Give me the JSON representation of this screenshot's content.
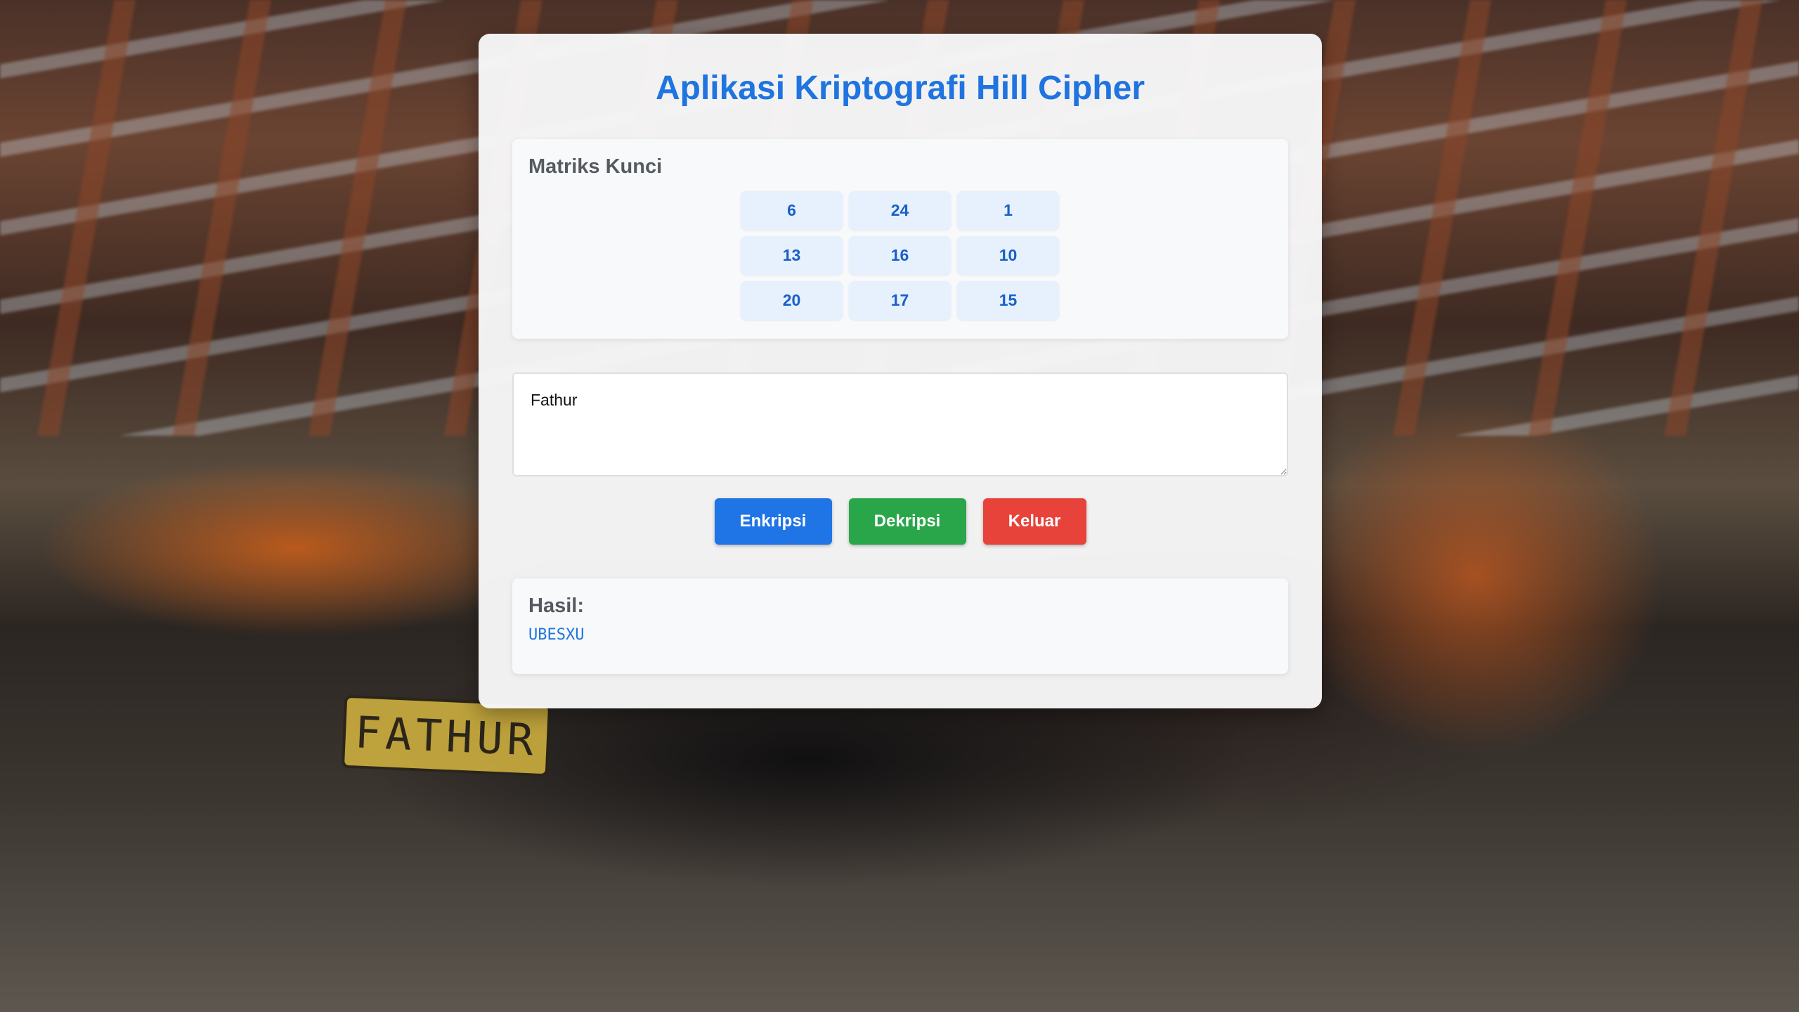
{
  "app": {
    "title": "Aplikasi Kriptografi Hill Cipher"
  },
  "matrix": {
    "label": "Matriks Kunci",
    "rows": [
      [
        "6",
        "24",
        "1"
      ],
      [
        "13",
        "16",
        "10"
      ],
      [
        "20",
        "17",
        "15"
      ]
    ]
  },
  "input": {
    "value": "Fathur"
  },
  "actions": {
    "encrypt_label": "Enkripsi",
    "decrypt_label": "Dekripsi",
    "exit_label": "Keluar"
  },
  "result": {
    "label": "Hasil:",
    "value": "UBESXU"
  },
  "background": {
    "plate_text": "FATHUR"
  },
  "colors": {
    "accent": "#1f74e0",
    "encrypt": "#1f74e6",
    "decrypt": "#2aa64a",
    "exit": "#e8433a"
  }
}
